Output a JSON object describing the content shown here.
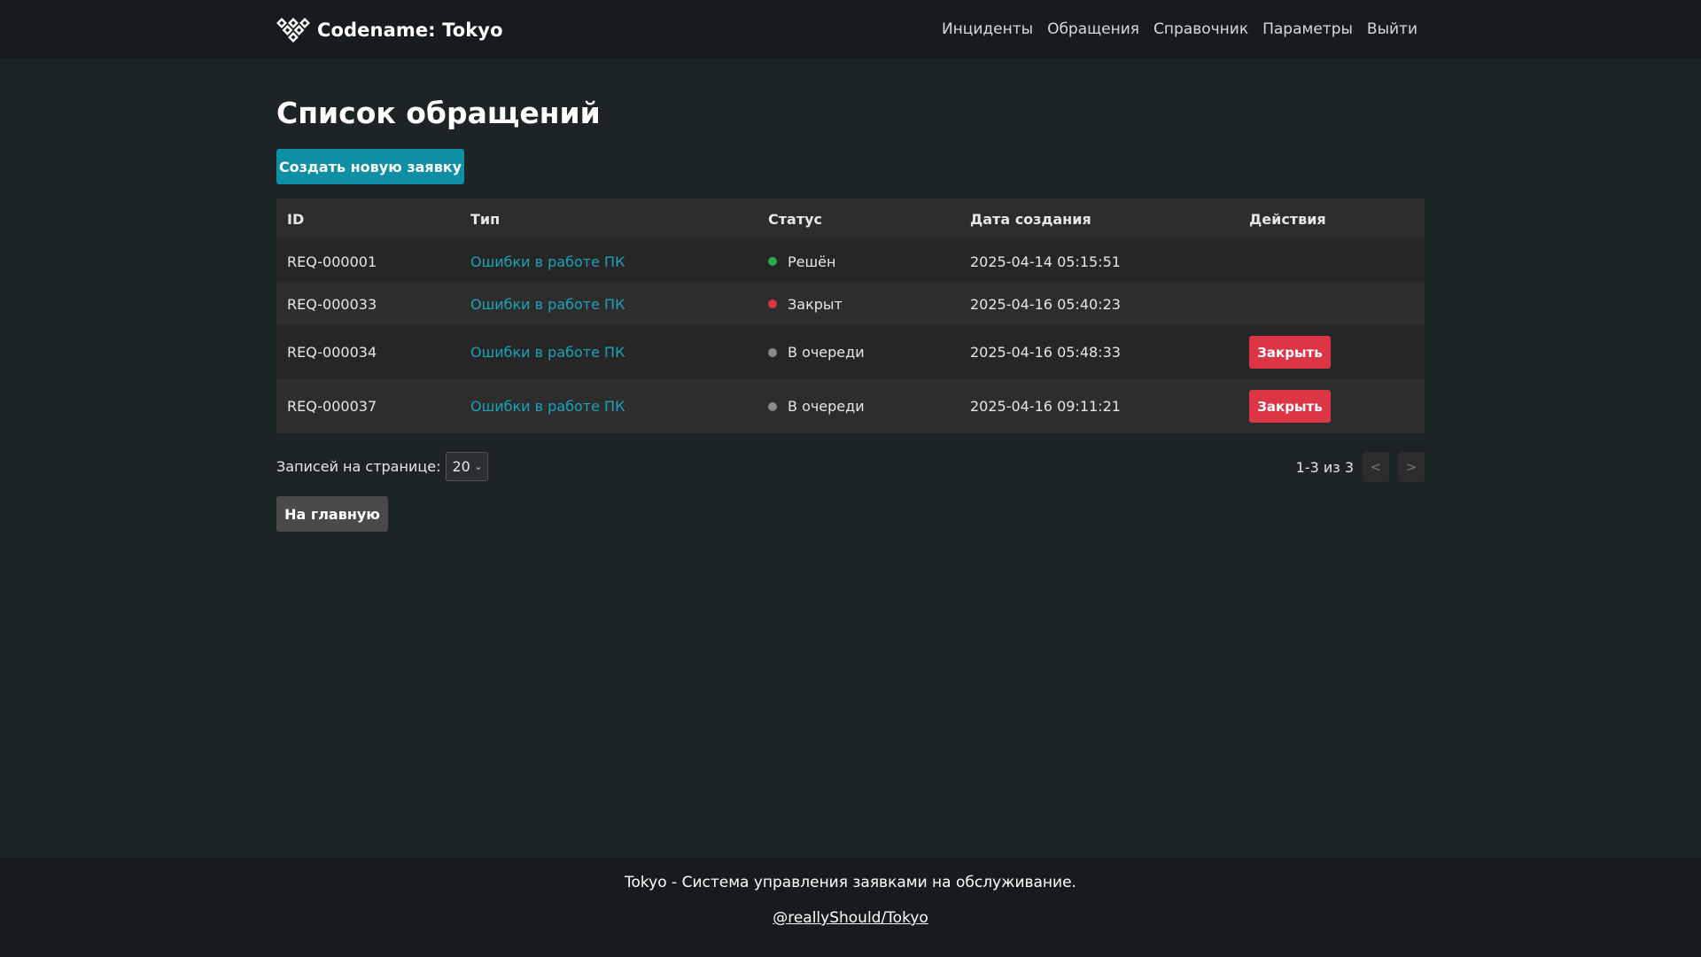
{
  "header": {
    "brand_name": "Codename: Tokyo",
    "nav": [
      "Инциденты",
      "Обращения",
      "Справочник",
      "Параметры",
      "Выйти"
    ]
  },
  "page_title": "Список обращений",
  "create_button": "Создать новую заявку",
  "table": {
    "columns": [
      "ID",
      "Тип",
      "Статус",
      "Дата создания",
      "Действия"
    ],
    "rows": [
      {
        "id": "REQ-000001",
        "type": "Ошибки в работе ПК",
        "status": "Решён",
        "status_color": "#28a745",
        "date": "2025-04-14 05:15:51",
        "action": ""
      },
      {
        "id": "REQ-000033",
        "type": "Ошибки в работе ПК",
        "status": "Закрыт",
        "status_color": "#dc3545",
        "date": "2025-04-16 05:40:23",
        "action": ""
      },
      {
        "id": "REQ-000034",
        "type": "Ошибки в работе ПК",
        "status": "В очереди",
        "status_color": "#8a8a8a",
        "date": "2025-04-16 05:48:33",
        "action": "Закрыть"
      },
      {
        "id": "REQ-000037",
        "type": "Ошибки в работе ПК",
        "status": "В очереди",
        "status_color": "#8a8a8a",
        "date": "2025-04-16 09:11:21",
        "action": "Закрыть"
      }
    ]
  },
  "per_page": {
    "label": "Записей на странице:",
    "value": "20"
  },
  "pagination": {
    "info": "1-3 из 3",
    "prev": "<",
    "next": ">"
  },
  "home_button": "На главную",
  "footer": {
    "text": "Tokyo - Система управления заявками на обслуживание.",
    "link": "@reallyShould/Tokyo"
  }
}
